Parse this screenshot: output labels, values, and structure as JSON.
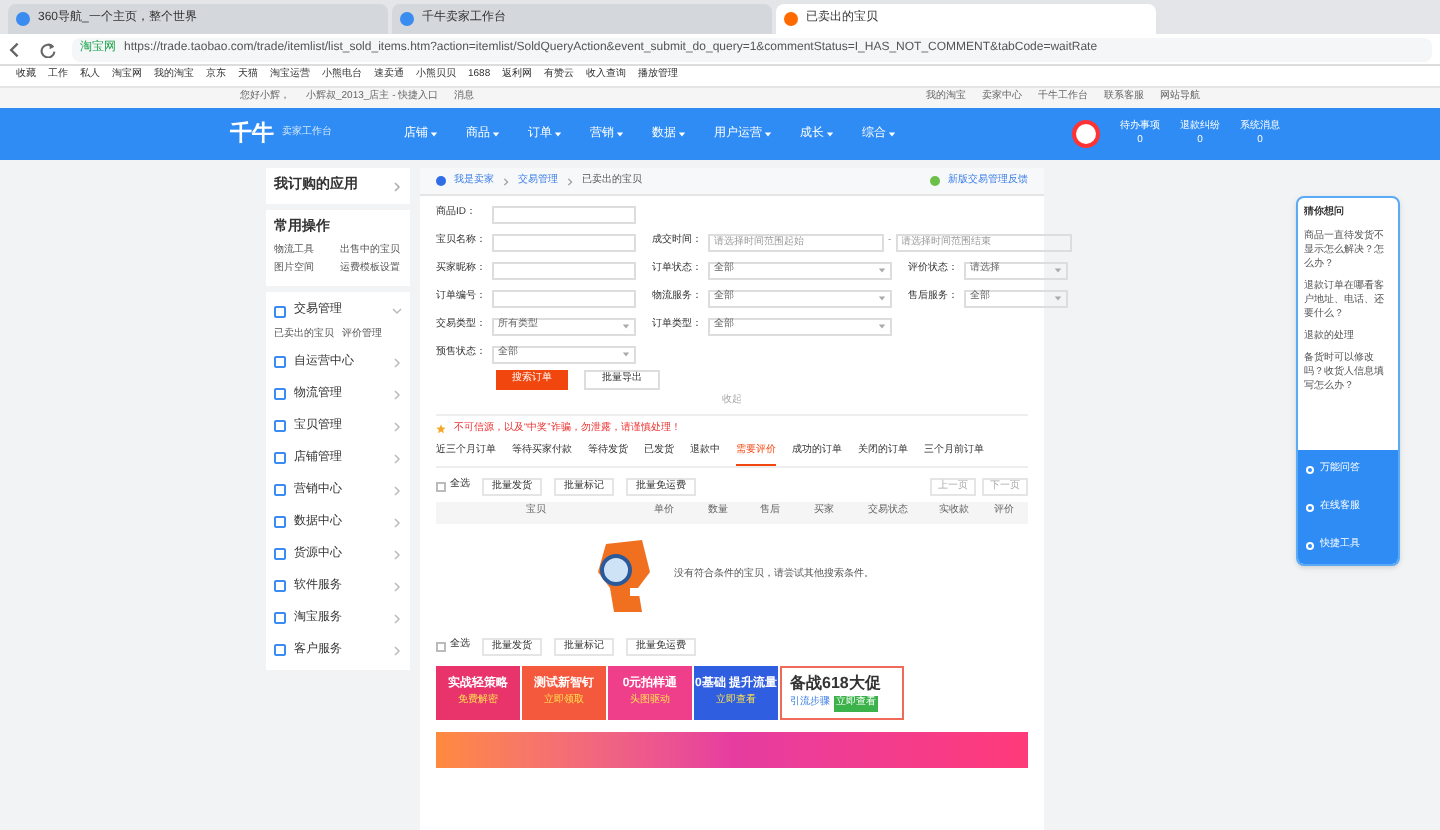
{
  "browser": {
    "tabs": [
      {
        "label": "360导航_一个主页，整个世界",
        "selected": false
      },
      {
        "label": "千牛卖家工作台",
        "selected": false
      },
      {
        "label": "已卖出的宝贝",
        "selected": true
      }
    ],
    "url_secure": "淘宝网",
    "url": "https://trade.taobao.com/trade/itemlist/list_sold_items.htm?action=itemlist/SoldQueryAction&event_submit_do_query=1&commentStatus=I_HAS_NOT_COMMENT&tabCode=waitRate",
    "bookmarks": [
      "收藏",
      "工作",
      "私人",
      "淘宝网",
      "我的淘宝",
      "京东",
      "天猫",
      "淘宝运营",
      "小熊电台",
      "速卖通",
      "小熊贝贝",
      "1688",
      "返利网",
      "有赞云",
      "收入查询",
      "播放管理"
    ]
  },
  "site_bar": {
    "left": [
      "您好小辉，",
      "小辉叔_2013_店主 - 快捷入口",
      "消息"
    ],
    "right": [
      "我的淘宝",
      "卖家中心",
      "千牛工作台",
      "联系客服",
      "网站导航"
    ]
  },
  "header": {
    "logo": "千牛",
    "subtitle": "卖家工作台",
    "nav": [
      "店铺",
      "商品",
      "订单",
      "营销",
      "数据",
      "用户运营",
      "成长",
      "综合"
    ],
    "stats": [
      {
        "label": "待办事项",
        "value": "0"
      },
      {
        "label": "退款纠纷",
        "value": "0"
      },
      {
        "label": "系统消息",
        "value": "0"
      }
    ]
  },
  "sidebar": {
    "apps": "我订购的应用",
    "common": {
      "title": "常用操作",
      "links": [
        "物流工具",
        "出售中的宝贝",
        "图片空间",
        "运费模板设置"
      ]
    },
    "items": [
      {
        "label": "交易管理",
        "expanded": true,
        "children": [
          "已卖出的宝贝",
          "评价管理"
        ]
      },
      {
        "label": "自运营中心",
        "expanded": false
      },
      {
        "label": "物流管理",
        "expanded": false
      },
      {
        "label": "宝贝管理",
        "expanded": false
      },
      {
        "label": "店铺管理",
        "expanded": false
      },
      {
        "label": "营销中心",
        "expanded": false
      },
      {
        "label": "数据中心",
        "expanded": false
      },
      {
        "label": "货源中心",
        "expanded": false
      },
      {
        "label": "软件服务",
        "expanded": false
      },
      {
        "label": "淘宝服务",
        "expanded": false
      },
      {
        "label": "客户服务",
        "expanded": false
      }
    ]
  },
  "breadcrumb": [
    "我是卖家",
    "交易管理",
    "已卖出的宝贝"
  ],
  "feedback": "新版交易管理反馈",
  "form": {
    "fields": [
      {
        "label": "商品ID：",
        "kind": "input"
      },
      {
        "label": "宝贝名称：",
        "kind": "input"
      },
      {
        "label": "成交时间：",
        "kind": "range",
        "placeholder": "请选择时间范围起始",
        "placeholder_end": "请选择时间范围结束",
        "separator": "-"
      },
      {
        "label": "买家昵称：",
        "kind": "input"
      },
      {
        "label": "订单状态：",
        "kind": "select",
        "value": "全部"
      },
      {
        "label": "评价状态：",
        "kind": "select",
        "value": "请选择"
      },
      {
        "label": "订单编号：",
        "kind": "input"
      },
      {
        "label": "物流服务：",
        "kind": "select",
        "value": "全部"
      },
      {
        "label": "售后服务：",
        "kind": "select",
        "value": "全部"
      },
      {
        "label": "交易类型：",
        "kind": "select",
        "value": "所有类型"
      },
      {
        "label": "订单类型：",
        "kind": "select",
        "value": "全部"
      },
      {
        "label": "预售状态：",
        "kind": "select",
        "value": "全部"
      }
    ],
    "search": "搜索订单",
    "export": "批量导出",
    "collapse": "收起"
  },
  "warning": "不可信源，以及“中奖”诈骗，勿泄露，请谨慎处理！",
  "tabs": [
    {
      "label": "近三个月订单",
      "selected": false
    },
    {
      "label": "等待买家付款",
      "selected": false
    },
    {
      "label": "等待发货",
      "selected": false
    },
    {
      "label": "已发货",
      "selected": false
    },
    {
      "label": "退款中",
      "selected": false
    },
    {
      "label": "需要评价",
      "selected": true
    },
    {
      "label": "成功的订单",
      "selected": false
    },
    {
      "label": "关闭的订单",
      "selected": false
    },
    {
      "label": "三个月前订单",
      "selected": false
    }
  ],
  "actions": {
    "select_all": "全选",
    "checked": false,
    "buttons": [
      "批量发货",
      "批量标记",
      "批量免运费"
    ]
  },
  "actions_bottom": {
    "select_all": "全选",
    "checked": false,
    "buttons": [
      "批量发货",
      "批量标记",
      "批量免运费"
    ]
  },
  "pager": [
    "上一页",
    "下一页"
  ],
  "columns": [
    "宝贝",
    "单价",
    "数量",
    "售后",
    "买家",
    "交易状态",
    "实收款",
    "评价"
  ],
  "empty": "没有符合条件的宝贝，请尝试其他搜索条件。",
  "banners": [
    {
      "title": "实战轻策略",
      "sub": "免费解密",
      "color": "#e8336b"
    },
    {
      "title": "测试新智钉",
      "sub": "立即领取",
      "color": "#f5593d"
    },
    {
      "title": "0元拍样通",
      "sub": "头图驱动",
      "color": "#ef3f8a"
    },
    {
      "title": "0基础 提升流量",
      "sub": "立即查看",
      "color": "#2f5ee0"
    },
    {
      "title": "备战618大促",
      "sub": "引流步骤",
      "tag": "立即查看",
      "color": "#ffffff"
    }
  ],
  "help": {
    "title": "猜你想问",
    "questions": [
      "商品一直待发货不显示怎么解决？怎么办？",
      "退款订单在哪看客户地址、电话、还要什么？",
      "退款的处理",
      "备货时可以修改吗？收货人信息填写怎么办？"
    ],
    "buttons": [
      "万能问答",
      "在线客服",
      "快捷工具"
    ]
  }
}
